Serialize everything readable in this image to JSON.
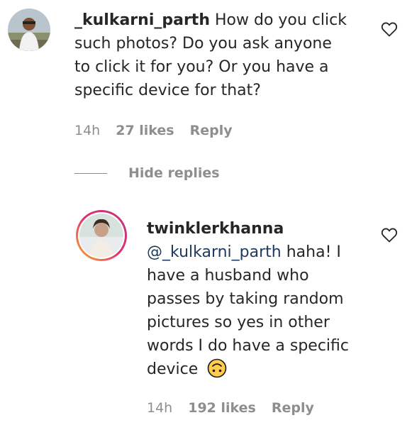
{
  "comment": {
    "username": "_kulkarni_parth",
    "text_lines": [
      "How do you click",
      "such photos? Do you ask anyone",
      "to click it for you? Or you have a",
      "specific device for that?"
    ],
    "time": "14h",
    "likes": "27 likes",
    "reply_label": "Reply"
  },
  "hide_replies_label": "Hide replies",
  "reply": {
    "username": "twinklerkhanna",
    "mention": "@_kulkarni_parth",
    "text_first": "haha! I",
    "text_lines": [
      "have a husband who",
      "passes by taking random",
      "pictures so yes in other",
      "words I do have a specific",
      "device"
    ],
    "emoji": "upside-down-face-icon",
    "time": "14h",
    "likes": "192 likes",
    "reply_label": "Reply"
  },
  "colors": {
    "text": "#262626",
    "meta": "#8e8e8e",
    "mention": "#1e3a61",
    "story_ring_start": "#f58529",
    "story_ring_end": "#c13584",
    "emoji_fill": "#ffcc4d"
  }
}
